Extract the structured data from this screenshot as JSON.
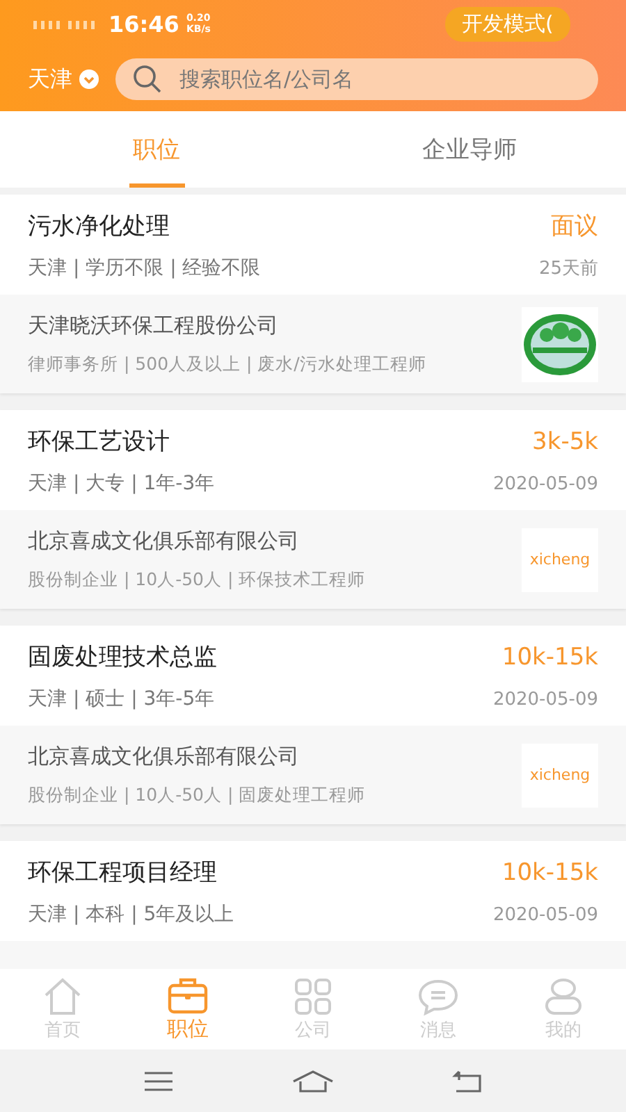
{
  "status_bar": {
    "time": "16:46",
    "speed_value": "0.20",
    "speed_unit": "KB/s",
    "badge": "开发模式("
  },
  "header": {
    "city": "天津",
    "search": {
      "placeholder": "搜索职位名/公司名"
    }
  },
  "tabs": [
    {
      "label": "职位",
      "selected": true
    },
    {
      "label": "企业导师",
      "selected": false
    }
  ],
  "jobs": [
    {
      "title": "污水净化处理",
      "salary": "面议",
      "meta": "天津 | 学历不限 | 经验不限",
      "date": "25天前",
      "company": {
        "name": "天津晓沃环保工程股份公司",
        "meta": "律师事务所 | 500人及以上 | 废水/污水处理工程师",
        "logo": {
          "kind": "emblem"
        }
      }
    },
    {
      "title": "环保工艺设计",
      "salary": "3k-5k",
      "meta": "天津 | 大专 | 1年-3年",
      "date": "2020-05-09",
      "company": {
        "name": "北京喜成文化俱乐部有限公司",
        "meta": "股份制企业 | 10人-50人 | 环保技术工程师",
        "logo": {
          "kind": "wordmark",
          "text": "xicheng"
        }
      }
    },
    {
      "title": "固废处理技术总监",
      "salary": "10k-15k",
      "meta": "天津 | 硕士 | 3年-5年",
      "date": "2020-05-09",
      "company": {
        "name": "北京喜成文化俱乐部有限公司",
        "meta": "股份制企业 | 10人-50人 | 固废处理工程师",
        "logo": {
          "kind": "wordmark",
          "text": "xicheng"
        }
      }
    },
    {
      "title": "环保工程项目经理",
      "salary": "10k-15k",
      "meta": "天津 | 本科 | 5年及以上",
      "date": "2020-05-09"
    }
  ],
  "bottom_nav": [
    {
      "label": "首页",
      "selected": false
    },
    {
      "label": "职位",
      "selected": true
    },
    {
      "label": "公司",
      "selected": false
    },
    {
      "label": "消息",
      "selected": false
    },
    {
      "label": "我的",
      "selected": false
    }
  ]
}
